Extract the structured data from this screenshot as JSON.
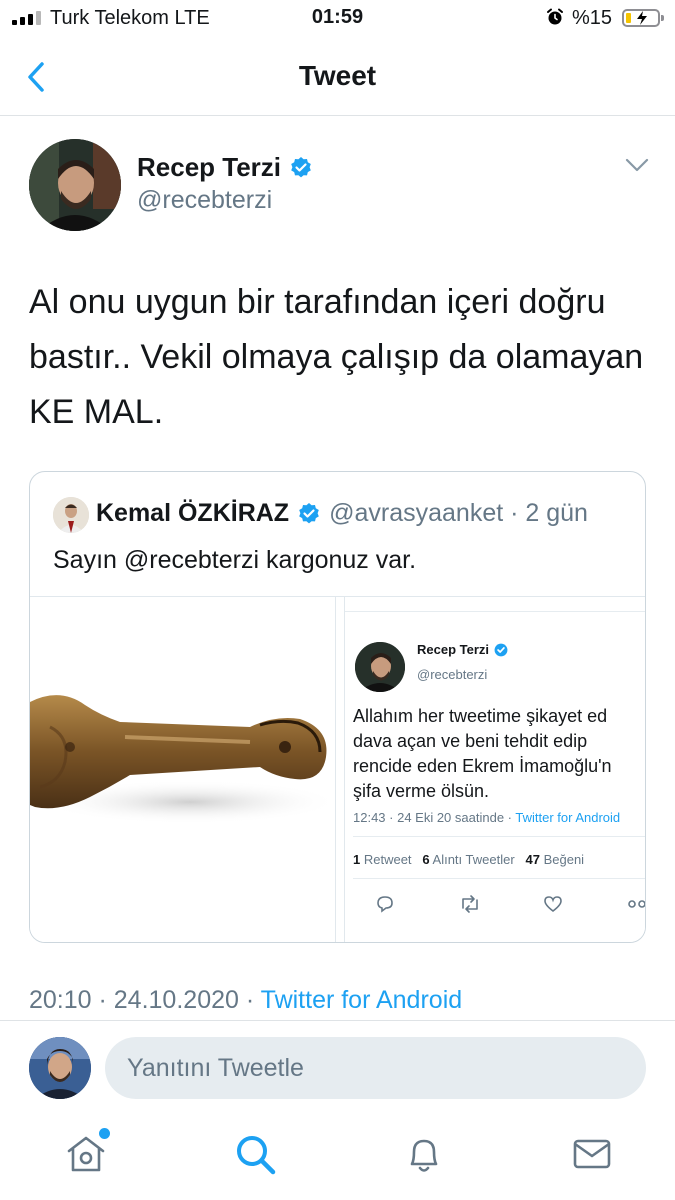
{
  "status_bar": {
    "carrier": "Turk Telekom  LTE",
    "time": "01:59",
    "battery_percent": "%15",
    "battery_level": 0.15
  },
  "nav": {
    "title": "Tweet",
    "back_icon": "chevron-left-icon"
  },
  "tweet": {
    "author_name": "Recep Terzi",
    "author_handle": "@recebterzi",
    "text": "Al onu uygun bir tarafından içeri doğru bastır.. Vekil olmaya çalışıp da olamayan KE MAL.",
    "meta_time": "20:10 · 24.10.2020 · ",
    "meta_source": "Twitter for Android"
  },
  "quoted_tweet": {
    "author_name": "Kemal ÖZKİRAZ",
    "author_handle": "@avrasyaanket · 2 gün",
    "text": "Sayın @recebterzi kargonuz var.",
    "screenshot": {
      "author_name": "Recep Terzi",
      "author_handle": "@recebterzi",
      "lines": [
        "Allahım her tweetime şikayet ed",
        "dava açan ve beni tehdit edip",
        "rencide eden Ekrem İmamoğlu'n",
        "şifa verme ölsün."
      ],
      "meta_time": "12:43 · 24 Eki 20 saatinde · ",
      "meta_source": "Twitter for Android",
      "retweet_count": "1",
      "retweet_label": " Retweet",
      "quote_count": "6",
      "quote_label": " Alıntı Tweetler",
      "like_count": "47",
      "like_label": " Beğeni"
    }
  },
  "reply": {
    "placeholder": "Yanıtını Tweetle"
  },
  "tabbar": {
    "items": [
      "home-icon",
      "search-icon",
      "notifications-icon",
      "messages-icon"
    ],
    "active": "search-icon"
  },
  "colors": {
    "accent": "#1da1f2",
    "secondary_text": "#657786",
    "border": "#ccd6dd"
  }
}
